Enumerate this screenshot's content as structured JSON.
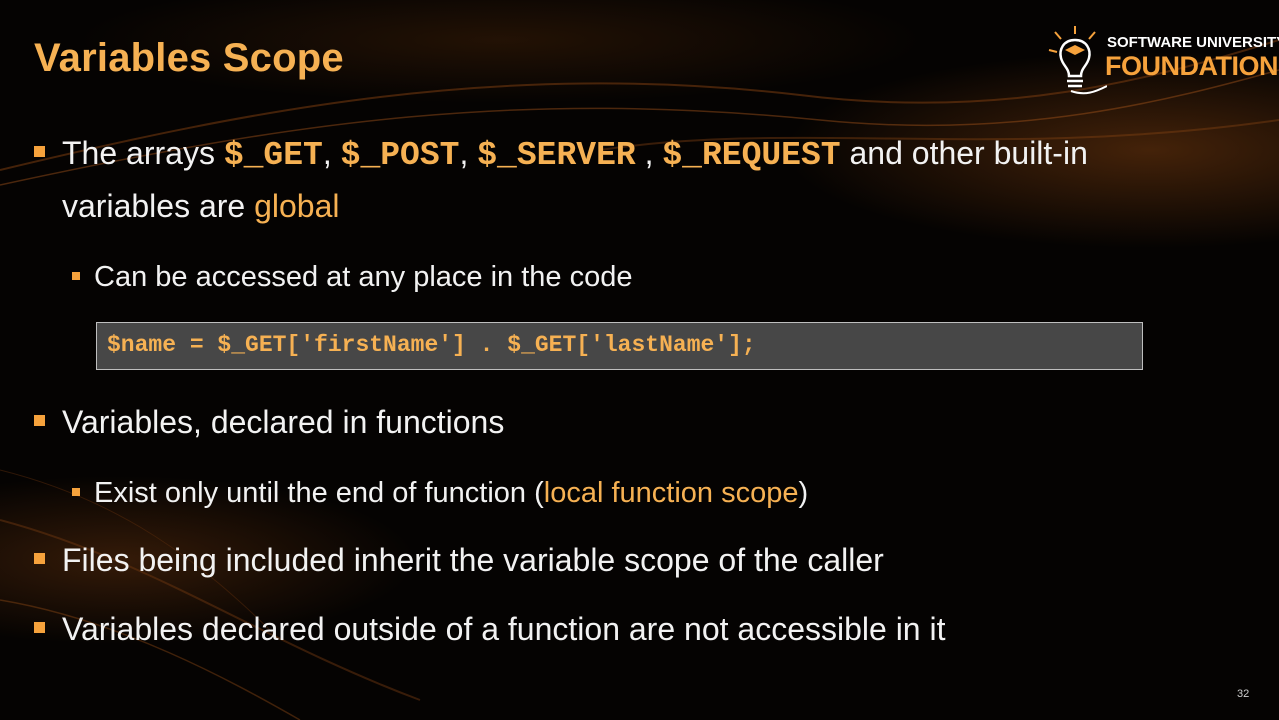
{
  "slide": {
    "title": "Variables Scope",
    "page_number": "32"
  },
  "logo": {
    "line1": "SOFTWARE UNIVERSITY",
    "line2": "FOUNDATION",
    "icon": "lightbulb-graduation-cap-icon",
    "accent": "#f6a23c"
  },
  "colors": {
    "title": "#f6b153",
    "highlight": "#f6b153",
    "bullet": "#f6a23c",
    "text": "#f2f2f2",
    "codebox_bg": "#474747"
  },
  "bullets": {
    "b1": {
      "t1": "The arrays ",
      "c1": "$_GET",
      "t2": ", ",
      "c2": "$_POST",
      "t3": ", ",
      "c3": "$_SERVER",
      "t4": " , ",
      "c4": "$_REQUEST",
      "t5": " and other built-in variables are ",
      "h1": "global"
    },
    "b1_sub1": "Can be accessed at any place in the code",
    "code": "$name = $_GET['firstName'] . $_GET['lastName'];",
    "b2": "Variables, declared in functions",
    "b2_sub1": {
      "t1": "Exist only until the end of function (",
      "h1": "local function scope",
      "t2": ")"
    },
    "b3": "Files being included inherit the variable scope of the caller",
    "b4": "Variables declared outside of a function are not accessible in it"
  }
}
